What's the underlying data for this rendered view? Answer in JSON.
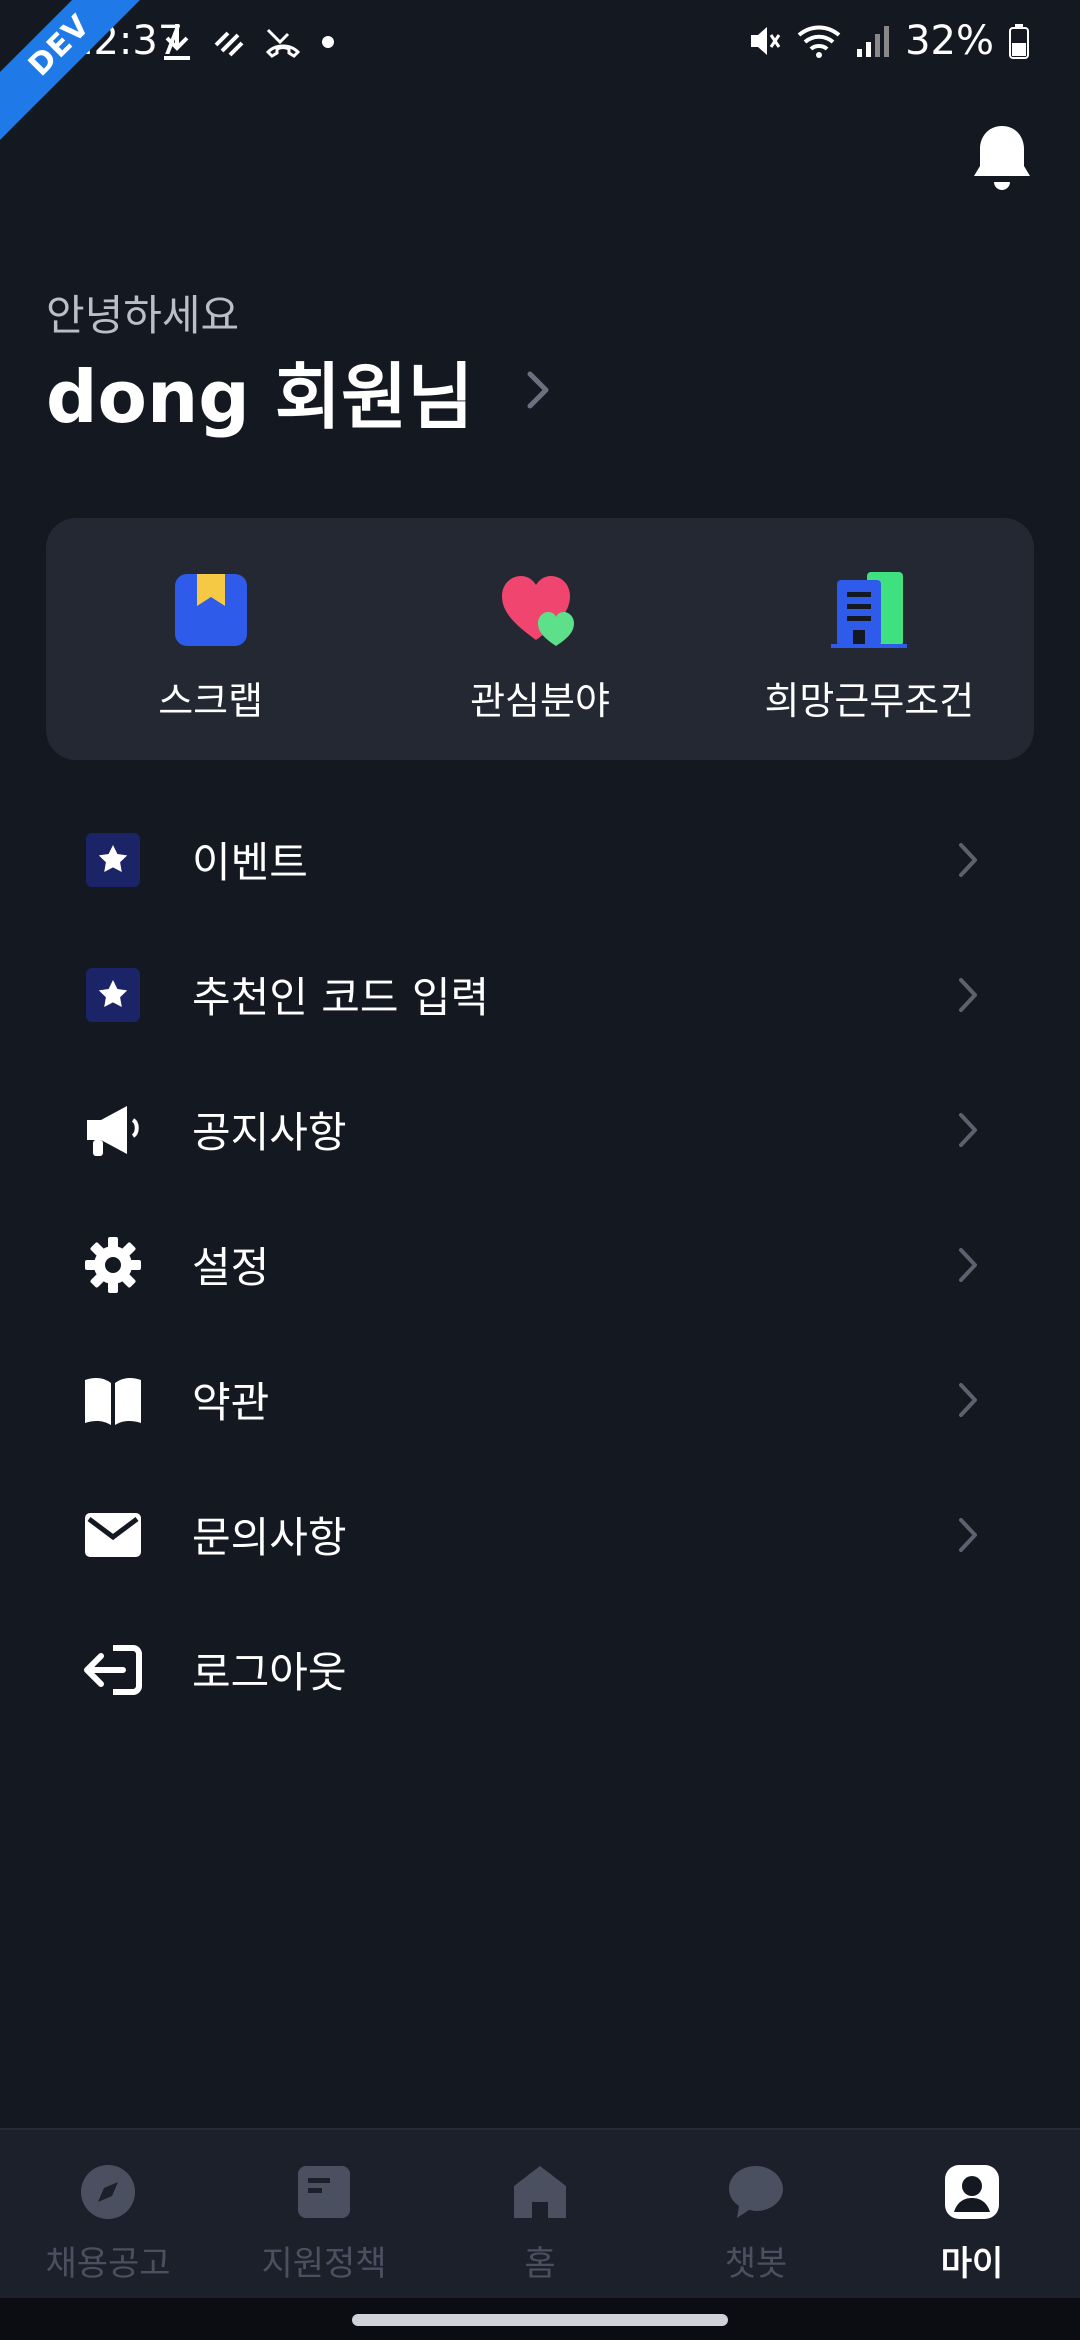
{
  "status_bar": {
    "time": "12:37",
    "battery": "32%",
    "dev_badge": "DEV"
  },
  "header": {
    "greeting": "안녕하세요",
    "user_name": "dong 회원님"
  },
  "quick_actions": [
    {
      "label": "스크랩",
      "icon": "bookmark-icon"
    },
    {
      "label": "관심분야",
      "icon": "hearts-icon"
    },
    {
      "label": "희망근무조건",
      "icon": "building-icon"
    }
  ],
  "menu": [
    {
      "label": "이벤트",
      "icon": "star-badge-icon",
      "has_chevron": true
    },
    {
      "label": "추천인 코드 입력",
      "icon": "star-badge-icon",
      "has_chevron": true
    },
    {
      "label": "공지사항",
      "icon": "megaphone-icon",
      "has_chevron": true
    },
    {
      "label": "설정",
      "icon": "gear-icon",
      "has_chevron": true
    },
    {
      "label": "약관",
      "icon": "book-icon",
      "has_chevron": true
    },
    {
      "label": "문의사항",
      "icon": "envelope-icon",
      "has_chevron": true
    },
    {
      "label": "로그아웃",
      "icon": "logout-icon",
      "has_chevron": false
    }
  ],
  "bottom_nav": [
    {
      "label": "채용공고",
      "icon": "compass-icon",
      "active": false
    },
    {
      "label": "지원정책",
      "icon": "document-icon",
      "active": false
    },
    {
      "label": "홈",
      "icon": "home-icon",
      "active": false
    },
    {
      "label": "챗봇",
      "icon": "chat-icon",
      "active": false
    },
    {
      "label": "마이",
      "icon": "person-icon",
      "active": true
    }
  ],
  "colors": {
    "background": "#141820",
    "card": "#232833",
    "accent_blue": "#2f5bea",
    "heart_pink": "#f0456f",
    "heart_green": "#5ee08a",
    "building_green": "#3fe07f"
  }
}
